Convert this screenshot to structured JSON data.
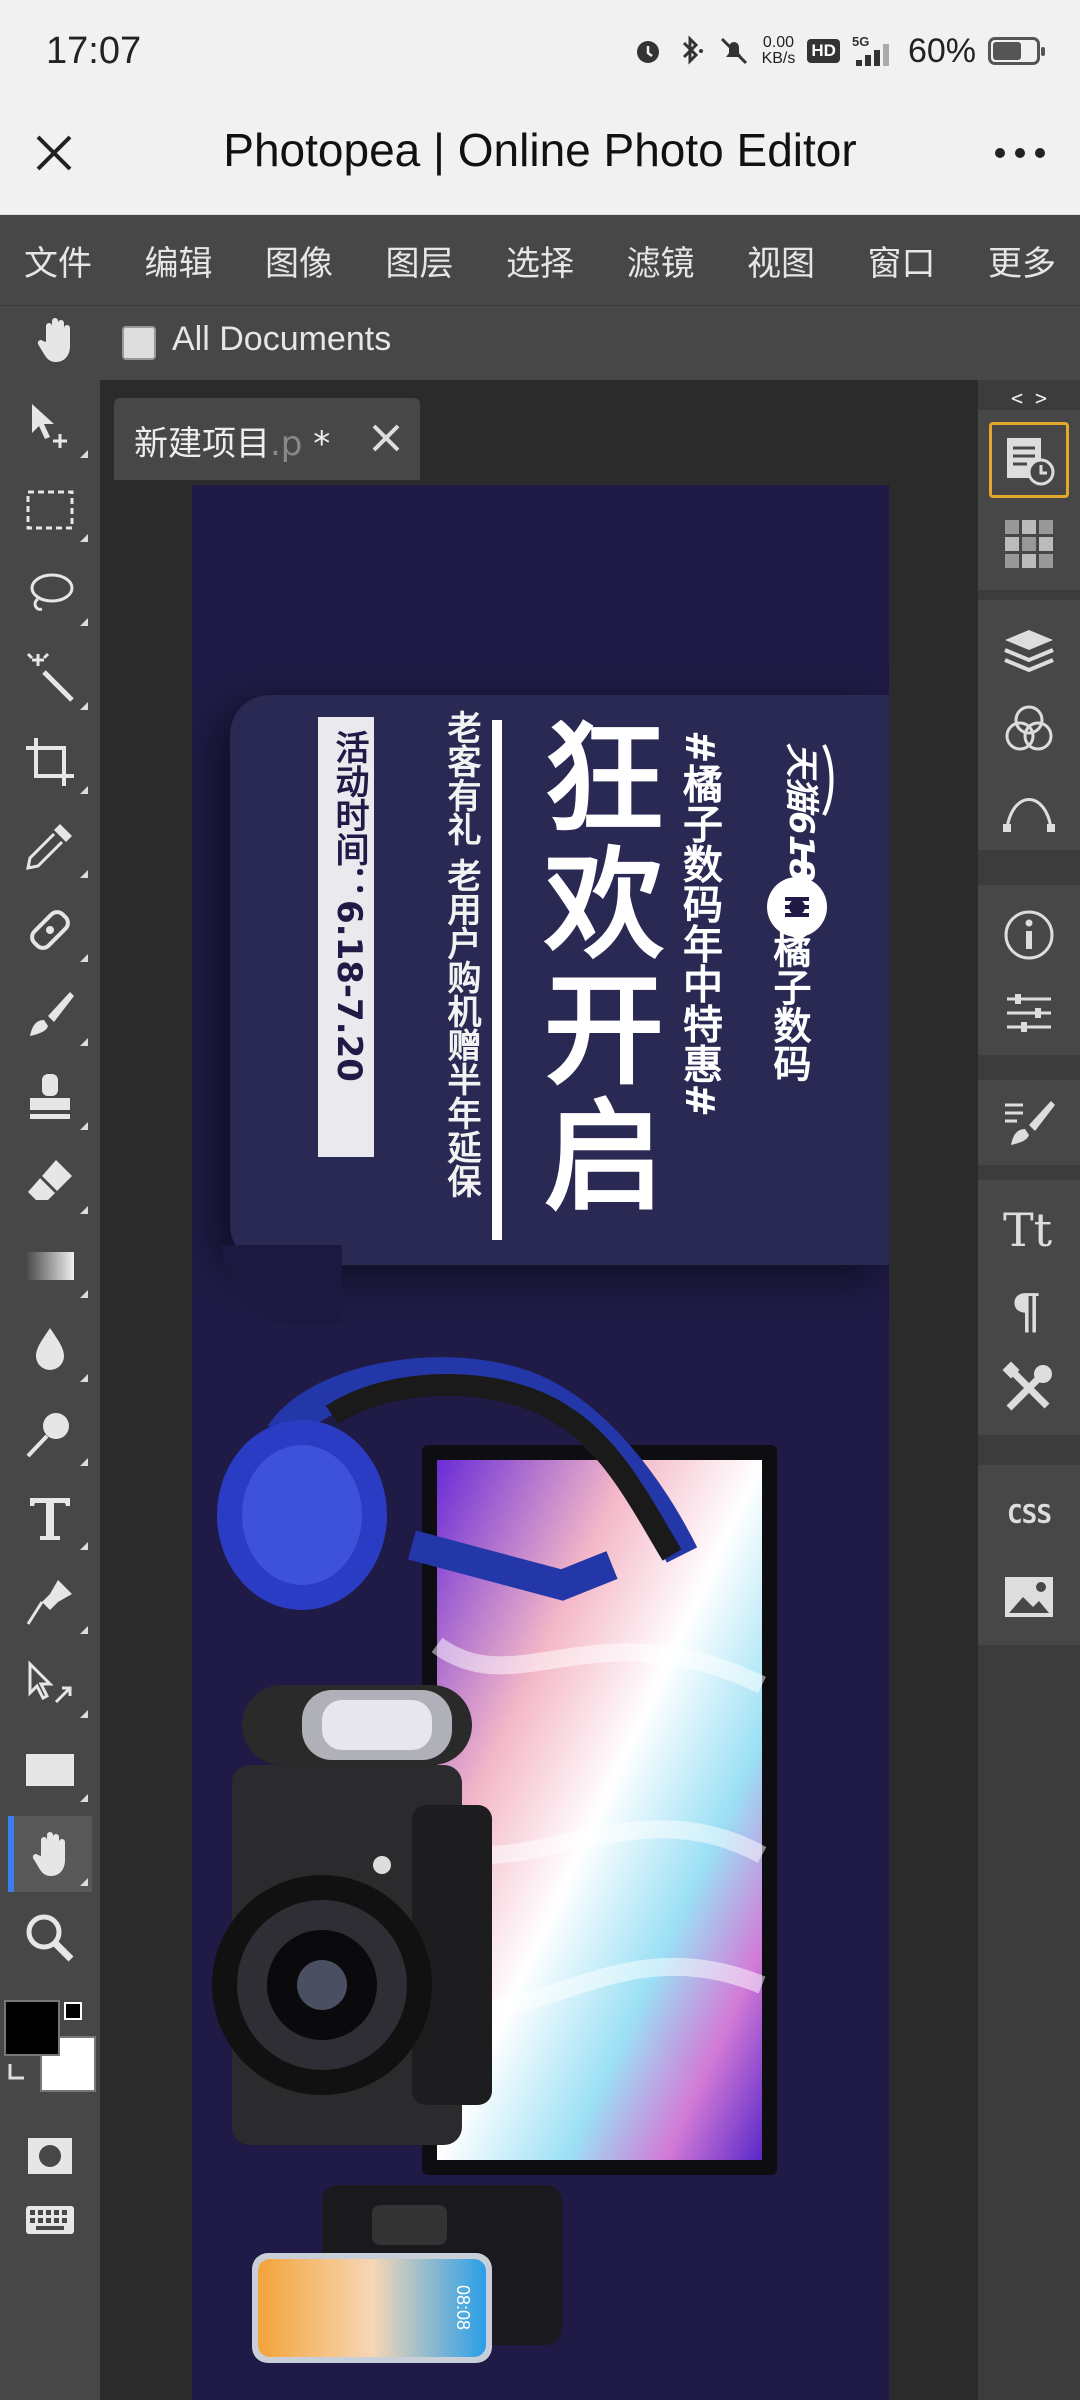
{
  "status_bar": {
    "time": "17:07",
    "net_speed_value": "0.00",
    "net_speed_unit": "KB/s",
    "hd_badge": "HD",
    "signal_label": "5G",
    "battery_percent": "60%",
    "battery_level": 0.6
  },
  "title_bar": {
    "title": "Photopea | Online Photo Editor"
  },
  "menu": [
    "文件",
    "编辑",
    "图像",
    "图层",
    "选择",
    "滤镜",
    "视图",
    "窗口",
    "更多"
  ],
  "options_bar": {
    "all_documents_label": "All Documents",
    "all_documents_checked": false
  },
  "document_tab": {
    "name": "新建项目",
    "ext": ".p",
    "modified_mark": " *"
  },
  "banner": {
    "logo_text": "天猫618",
    "brand": "橘子数码",
    "hashtag": "#橘子数码年中特惠#",
    "headline": "狂欢开启",
    "subline": "老客有礼  老用户购机赠半年延保",
    "date": "活动时间：6.18-7.20",
    "phone_time": "08:08",
    "bg_color": "#1f1b46",
    "panel_color": "#2a2953"
  },
  "right_dock": {
    "collapse_arrows": "< >",
    "css_label": "CSS"
  },
  "colors": {
    "foreground": "#000000",
    "background": "#ffffff",
    "accent": "#3b7ef0",
    "selected_border": "#e4a72c"
  }
}
